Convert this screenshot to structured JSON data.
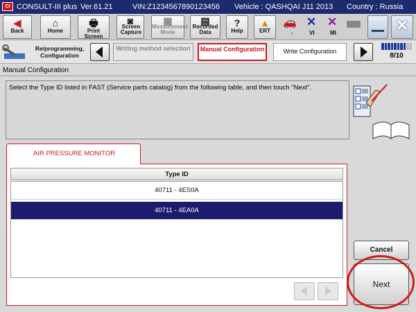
{
  "titlebar": {
    "logo": "CI",
    "app": "CONSULT-III plus",
    "version": "Ver.61.21",
    "vin": "VIN:Z1234567890123456",
    "vehicle": "Vehicle : QASHQAI J11 2013",
    "country": "Country : Russia"
  },
  "toolbar": {
    "back": "Back",
    "home": "Home",
    "print_screen": "Print Screen",
    "screen_capture": "Screen Capture",
    "measurement_mode": "Measurement Mode",
    "recorded_data": "Recorded Data",
    "help": "Help",
    "ert": "ERT",
    "status_vi": "VI",
    "status_mi": "MI",
    "status_dash": "-"
  },
  "breadcrumb": {
    "start": "Re/programming, Configuration",
    "step_done": "Writing method selection",
    "step_current": "Manual Configuration",
    "step_next": "Write Configuration",
    "progress": "8/10",
    "progress_value": 8,
    "progress_total": 10
  },
  "page": {
    "section_title": "Manual Configuration",
    "instruction": "Select the Type ID listed in FAST (Service parts catalog) from the following table, and then touch \"Next\"."
  },
  "tab": {
    "label": "AIR PRESSURE MONITOR"
  },
  "table": {
    "header": "Type ID",
    "rows": [
      "40711 - 4ES0A",
      "40711 - 4EA0A"
    ],
    "selected_row": 1
  },
  "buttons": {
    "cancel": "Cancel",
    "next": "Next"
  },
  "colors": {
    "accent": "#c8181e",
    "titlebar": "#1c2a6e",
    "selection": "#1c1c6e"
  }
}
